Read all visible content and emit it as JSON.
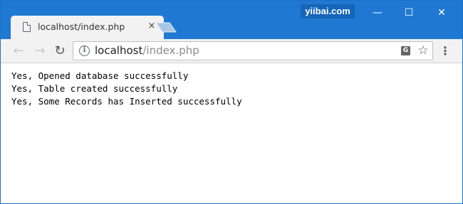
{
  "watermark": "yiibai.com",
  "window_controls": {
    "minimize": "—",
    "maximize": "☐",
    "close": "✕"
  },
  "tab": {
    "title": "localhost/index.php",
    "close": "×"
  },
  "toolbar": {
    "back": "←",
    "forward": "→",
    "reload": "↻",
    "menu": "⋮"
  },
  "address_bar": {
    "host": "localhost",
    "path": "/index.php",
    "info_icon": "i",
    "translate_icon": "G",
    "bookmark_icon": "☆"
  },
  "page": {
    "lines": [
      "Yes, Opened database successfully",
      "Yes, Table created successfully",
      "Yes, Some Records has Inserted successfully"
    ]
  },
  "colors": {
    "titlebar": "#1f78d1",
    "tab": "#f2f2f2",
    "toolbar": "#f2f2f2"
  }
}
